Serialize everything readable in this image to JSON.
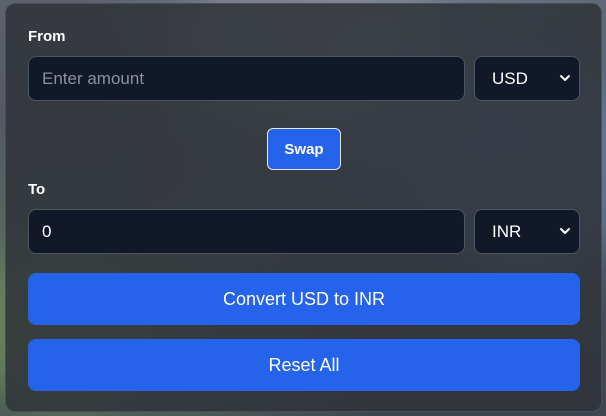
{
  "from": {
    "label": "From",
    "amount_placeholder": "Enter amount",
    "amount_value": "",
    "currency": "USD"
  },
  "swap_label": "Swap",
  "to": {
    "label": "To",
    "amount_value": "0",
    "currency": "INR"
  },
  "convert_label": "Convert USD to INR",
  "reset_label": "Reset All",
  "colors": {
    "accent": "#2563eb",
    "input_bg": "#111827",
    "card_bg": "#303339"
  },
  "icons": {
    "dropdown": "chevron-down-icon"
  }
}
